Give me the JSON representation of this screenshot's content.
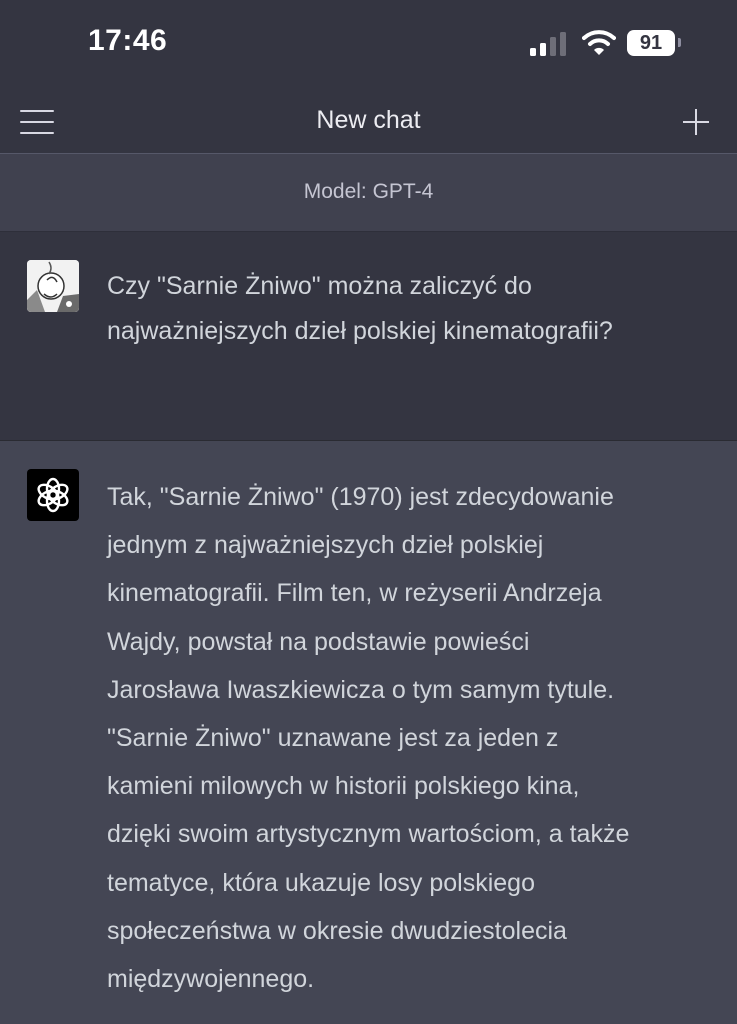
{
  "status_bar": {
    "time": "17:46",
    "battery_level": "91",
    "signal_bars_active": 2,
    "signal_bars_total": 4,
    "icons": [
      "cellular-signal-icon",
      "wifi-icon",
      "battery-icon"
    ]
  },
  "nav": {
    "title": "New chat",
    "menu_icon": "hamburger-menu-icon",
    "new_chat_icon": "plus-icon"
  },
  "model": {
    "label": "Model: GPT-4"
  },
  "messages": [
    {
      "role": "user",
      "avatar": "user-avatar-image",
      "lines": [
        "Czy \"Sarnie Żniwo\" można zaliczyć do",
        "najważniejszych dzieł polskiej kinematografii?"
      ]
    },
    {
      "role": "assistant",
      "avatar": "openai-logo-icon",
      "lines": [
        "Tak, \"Sarnie Żniwo\" (1970) jest zdecydowanie",
        "jednym z najważniejszych dzieł polskiej",
        "kinematografii. Film ten, w reżyserii Andrzeja",
        "Wajdy, powstał na podstawie powieści",
        "Jarosława Iwaszkiewicza o tym samym tytule.",
        "\"Sarnie Żniwo\" uznawane jest za jeden z",
        "kamieni milowych w historii polskiego kina,",
        "dzięki swoim artystycznym wartościom, a także",
        "tematyce, która ukazuje losy polskiego",
        "społeczeństwa w okresie dwudziestolecia",
        "międzywojennego."
      ]
    }
  ],
  "colors": {
    "background": "#343541",
    "assistant_background": "#444654",
    "model_bar": "#40414f",
    "text": "#d1d5db"
  }
}
